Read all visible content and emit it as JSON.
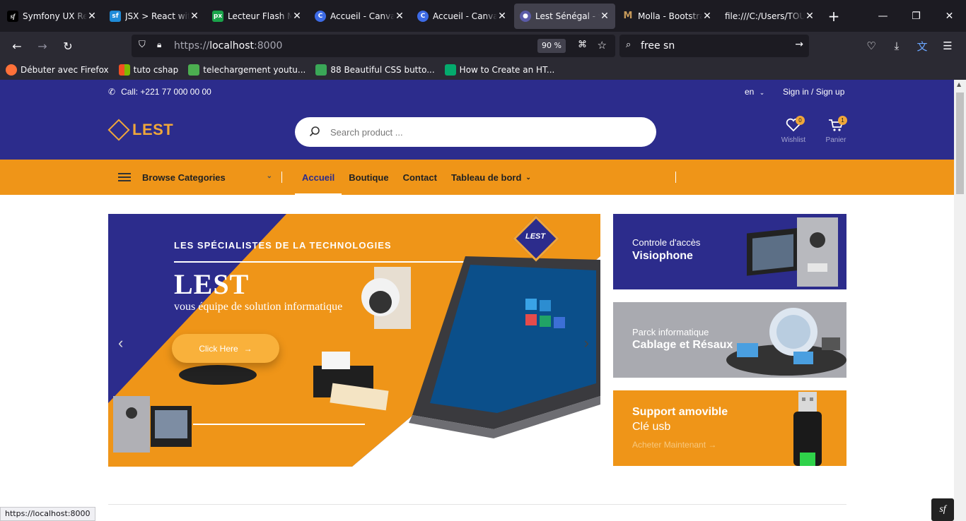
{
  "browser": {
    "tabs": [
      {
        "title": "Symfony UX React",
        "icon": "symfony-icon",
        "color": "#000000",
        "active": false
      },
      {
        "title": "JSX > React with Symfony",
        "icon": "symfony-docs-icon",
        "color": "#1f8bd8",
        "active": false
      },
      {
        "title": "Lecteur Flash Media",
        "icon": "px-icon",
        "color": "#1aa34a",
        "active": false
      },
      {
        "title": "Accueil - Canva",
        "icon": "canva-icon",
        "color": "#3d6be6",
        "active": false
      },
      {
        "title": "Accueil - Canva",
        "icon": "canva-icon",
        "color": "#3d6be6",
        "active": false
      },
      {
        "title": "Lest Sénégal - vente",
        "icon": "lest-icon",
        "color": "#5b5ba8",
        "active": true
      },
      {
        "title": "Molla - Bootstrap",
        "icon": "molla-icon",
        "color": "#c79a5a",
        "active": false
      },
      {
        "title": "file:///C:/Users/TOUR",
        "icon": "",
        "color": "",
        "active": false
      }
    ],
    "url_prefix": "https://",
    "url_host": "localhost",
    "url_port": ":8000",
    "zoom": "90 %",
    "search_text": "free sn",
    "bookmarks": [
      {
        "label": "Débuter avec Firefox",
        "color": "#ff7139"
      },
      {
        "label": "tuto cshap",
        "color": "#e8a21a"
      },
      {
        "label": "telechargement youtu...",
        "color": "#4caf50"
      },
      {
        "label": "88 Beautiful CSS butto...",
        "color": "#3aa757"
      },
      {
        "label": "How to Create an HT...",
        "color": "#04aa6d"
      }
    ],
    "status_url": "https://localhost:8000"
  },
  "site": {
    "topbar": {
      "call": "Call: +221 77 000 00 00",
      "lang": "en",
      "sign": "Sign in / Sign up"
    },
    "logo": "LEST",
    "search_placeholder": "Search product ...",
    "wishlist": {
      "label": "Wishlist",
      "count": "0"
    },
    "cart": {
      "label": "Panier",
      "count": "1"
    },
    "browse": "Browse Categories",
    "menu": [
      "Accueil",
      "Boutique",
      "Contact",
      "Tableau de bord"
    ],
    "hero": {
      "tagline": "LES SPÉCIALISTES DE LA TECHNOLOGIES",
      "title": "LEST",
      "subtitle": "vous équipe de solution informatique",
      "button": "Click Here",
      "badge": "LEST"
    },
    "side_banners": [
      {
        "line1": "Controle d'accès",
        "line2": "Visiophone",
        "line3": "",
        "bg": "#2c2c8c"
      },
      {
        "line1": "Parck informatique",
        "line2": "Cablage et Résaux",
        "line3": "",
        "bg": "#a9aab0"
      },
      {
        "line1": "Support amovible",
        "line2": "Clé usb",
        "line3": "Acheter Maintenant",
        "bg": "#ef9518"
      }
    ],
    "colors": {
      "primary": "#2c2c8c",
      "accent": "#ef9518"
    }
  }
}
